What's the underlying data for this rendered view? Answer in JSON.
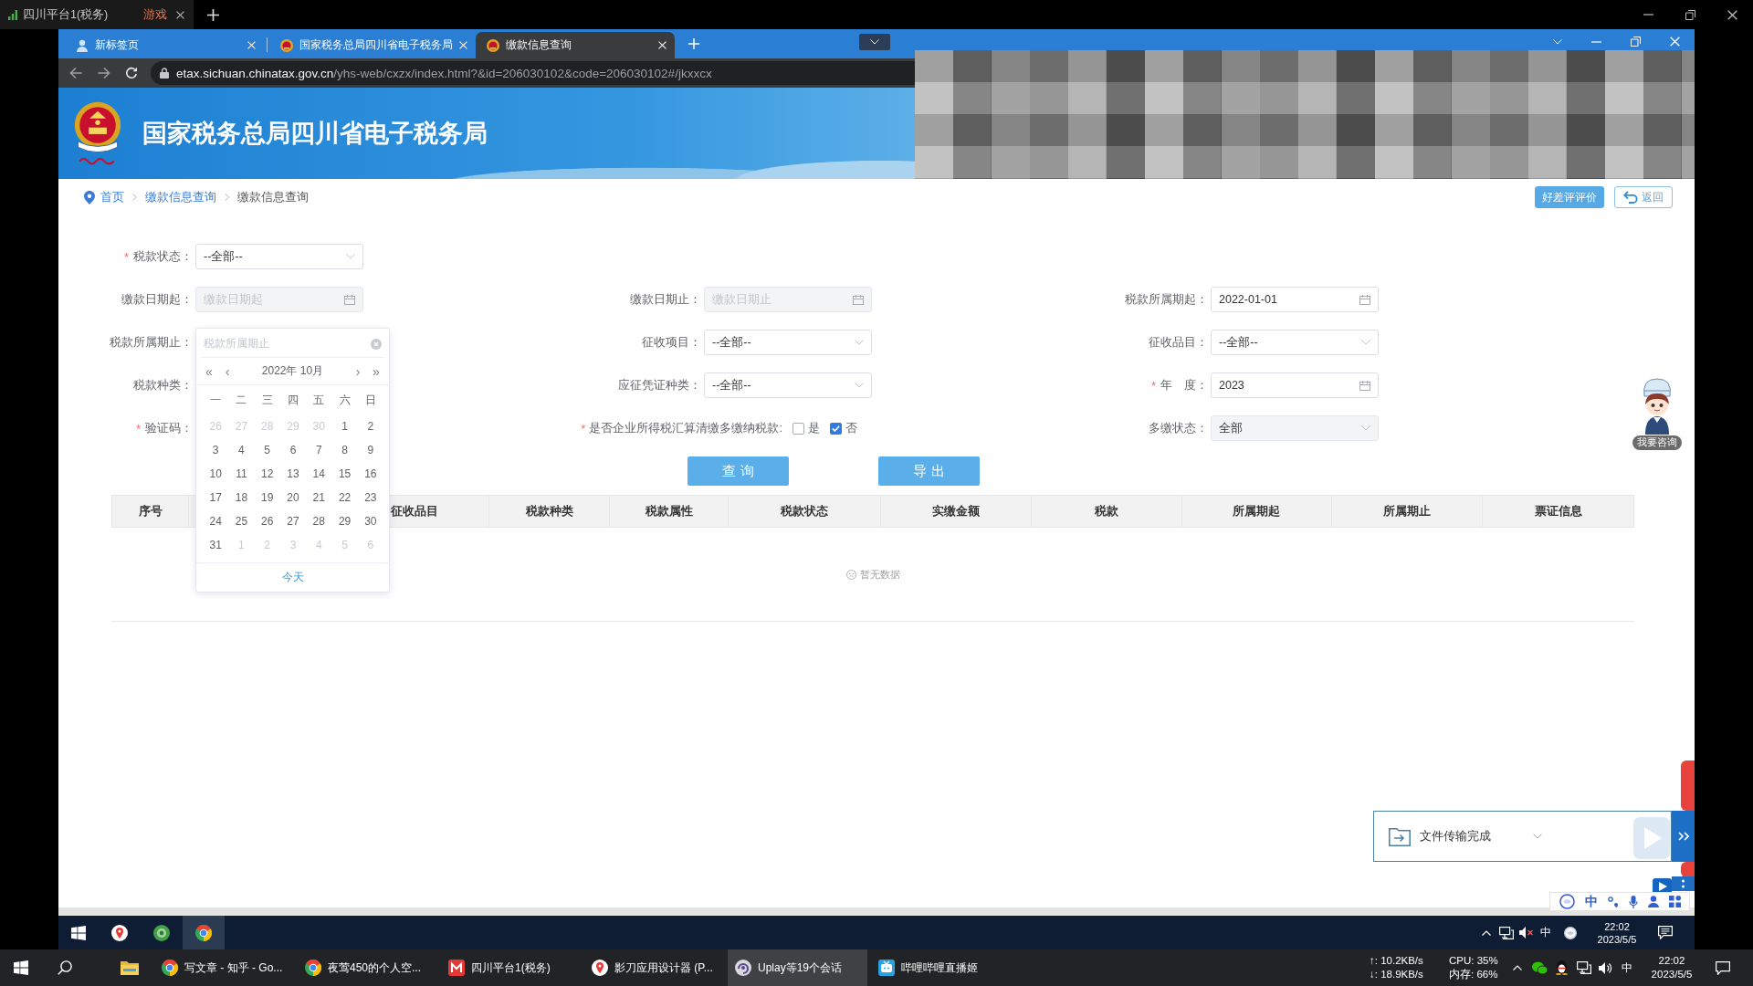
{
  "outer_window": {
    "tab": {
      "title": "四川平台1(税务)",
      "tag": "游戏"
    }
  },
  "browser": {
    "tabs": [
      {
        "title": "新标签页",
        "kind": "newtab",
        "selected": false
      },
      {
        "title": "国家税务总局四川省电子税务局",
        "kind": "site",
        "selected": false
      },
      {
        "title": "缴款信息查询",
        "kind": "site",
        "selected": true
      }
    ],
    "url": {
      "host": "etax.sichuan.chinatax.gov.cn",
      "path": "/yhs-web/cxzx/index.html?&id=206030102&code=206030102#/jkxxcx"
    }
  },
  "site_header": {
    "title": "国家税务总局四川省电子税务局"
  },
  "breadcrumb": [
    {
      "label": "首页",
      "kind": "link"
    },
    {
      "label": "缴款信息查询",
      "kind": "link"
    },
    {
      "label": "缴款信息查询",
      "kind": "current"
    }
  ],
  "header_actions": [
    {
      "label": "好差评评价",
      "kind": "primary"
    },
    {
      "label": "返回",
      "kind": "back"
    }
  ],
  "form": {
    "rows": [
      {
        "fields": [
          {
            "required_mark": "*",
            "label": "税款状态：",
            "kind": "select",
            "value": "--全部--",
            "disabled": false
          }
        ]
      },
      {
        "fields": [
          {
            "label": "缴款日期起：",
            "kind": "date",
            "placeholder": "缴款日期起",
            "disabled": true
          },
          {
            "label": "缴款日期止：",
            "kind": "date",
            "placeholder": "缴款日期止",
            "disabled": true
          },
          {
            "label": "税款所属期起：",
            "kind": "date",
            "value": "2022-01-01",
            "disabled": false
          }
        ]
      },
      {
        "fields": [
          {
            "label": "税款所属期止：",
            "kind": "datepicker",
            "placeholder": "税款所属期止",
            "calendar": {
              "nav": [
                "«",
                "‹",
                "›",
                "»"
              ],
              "title": "2022年 10月",
              "weekdays": [
                "一",
                "二",
                "三",
                "四",
                "五",
                "六",
                "日"
              ],
              "days": [
                {
                  "day": "26",
                  "outside": true
                },
                {
                  "day": "27",
                  "outside": true
                },
                {
                  "day": "28",
                  "outside": true
                },
                {
                  "day": "29",
                  "outside": true
                },
                {
                  "day": "30",
                  "outside": true
                },
                {
                  "day": "1",
                  "outside": false
                },
                {
                  "day": "2",
                  "outside": false
                },
                {
                  "day": "3",
                  "outside": false
                },
                {
                  "day": "4",
                  "outside": false
                },
                {
                  "day": "5",
                  "outside": false
                },
                {
                  "day": "6",
                  "outside": false
                },
                {
                  "day": "7",
                  "outside": false
                },
                {
                  "day": "8",
                  "outside": false
                },
                {
                  "day": "9",
                  "outside": false
                },
                {
                  "day": "10",
                  "outside": false
                },
                {
                  "day": "11",
                  "outside": false
                },
                {
                  "day": "12",
                  "outside": false
                },
                {
                  "day": "13",
                  "outside": false
                },
                {
                  "day": "14",
                  "outside": false
                },
                {
                  "day": "15",
                  "outside": false
                },
                {
                  "day": "16",
                  "outside": false
                },
                {
                  "day": "17",
                  "outside": false
                },
                {
                  "day": "18",
                  "outside": false
                },
                {
                  "day": "19",
                  "outside": false
                },
                {
                  "day": "20",
                  "outside": false
                },
                {
                  "day": "21",
                  "outside": false
                },
                {
                  "day": "22",
                  "outside": false
                },
                {
                  "day": "23",
                  "outside": false
                },
                {
                  "day": "24",
                  "outside": false
                },
                {
                  "day": "25",
                  "outside": false
                },
                {
                  "day": "26",
                  "outside": false
                },
                {
                  "day": "27",
                  "outside": false
                },
                {
                  "day": "28",
                  "outside": false
                },
                {
                  "day": "29",
                  "outside": false
                },
                {
                  "day": "30",
                  "outside": false
                },
                {
                  "day": "31",
                  "outside": false
                },
                {
                  "day": "1",
                  "outside": true
                },
                {
                  "day": "2",
                  "outside": true
                },
                {
                  "day": "3",
                  "outside": true
                },
                {
                  "day": "4",
                  "outside": true
                },
                {
                  "day": "5",
                  "outside": true
                },
                {
                  "day": "6",
                  "outside": true
                }
              ],
              "today": "今天"
            }
          },
          {
            "label": "征收项目：",
            "kind": "select",
            "value": "--全部--",
            "disabled": false
          },
          {
            "label": "征收品目：",
            "kind": "select",
            "value": "--全部--",
            "disabled": false
          }
        ]
      },
      {
        "fields": [
          {
            "label": "税款种类：",
            "kind": "covered"
          },
          {
            "label": "应征凭证种类：",
            "kind": "select",
            "value": "--全部--",
            "disabled": false
          },
          {
            "required_mark": "*",
            "label": "年　度：",
            "kind": "date",
            "value": "2023",
            "disabled": false
          }
        ]
      },
      {
        "fields": [
          {
            "required_mark": "*",
            "label": "验证码：",
            "kind": "covered"
          },
          {
            "required_mark": "*",
            "label": "是否企业所得税汇算清缴多缴纳税款:",
            "kind": "checkboxes",
            "options": [
              {
                "label": "是",
                "checked": false
              },
              {
                "label": "否",
                "checked": true
              }
            ]
          },
          {
            "label": "多缴状态：",
            "kind": "select",
            "value": "全部",
            "disabled": true
          }
        ]
      }
    ]
  },
  "actions": [
    {
      "label": "查 询"
    },
    {
      "label": "导 出"
    }
  ],
  "table": {
    "columns": [
      "序号",
      "征收品目",
      "税款种类",
      "税款属性",
      "税款状态",
      "实缴金额",
      "税款",
      "所属期起",
      "所属期止",
      "票证信息"
    ],
    "empty_text": "暂无数据"
  },
  "consult": {
    "label": "我要咨询"
  },
  "transfer_panel": {
    "text": "文件传输完成"
  },
  "ime_bar": {
    "mode": "中"
  },
  "inner_taskbar": {
    "apps": [
      {
        "kind": "bot",
        "selected": false
      },
      {
        "kind": "orb",
        "selected": false
      },
      {
        "kind": "chrome",
        "selected": true
      }
    ],
    "ime": "中",
    "time": "22:02",
    "date": "2023/5/5"
  },
  "taskbar": {
    "items": [
      {
        "label": "写文章 - 知乎 - Go...",
        "kind": "chrome",
        "selected": false
      },
      {
        "label": "夜莺450的个人空...",
        "kind": "chrome",
        "selected": false
      },
      {
        "label": "四川平台1(税务)",
        "kind": "remote",
        "selected": false
      },
      {
        "label": "影刀应用设计器 (P...",
        "kind": "bot",
        "selected": false
      },
      {
        "label": "Uplay等19个会话",
        "kind": "uplay",
        "selected": true
      },
      {
        "label": "哔哩哔哩直播姬",
        "kind": "live",
        "selected": false
      }
    ],
    "net_up": "↑: 10.2KB/s",
    "net_down": "↓: 18.9KB/s",
    "cpu": "CPU: 35%",
    "mem": "内存: 66%",
    "ime": "中",
    "time": "22:02",
    "date": "2023/5/5"
  }
}
